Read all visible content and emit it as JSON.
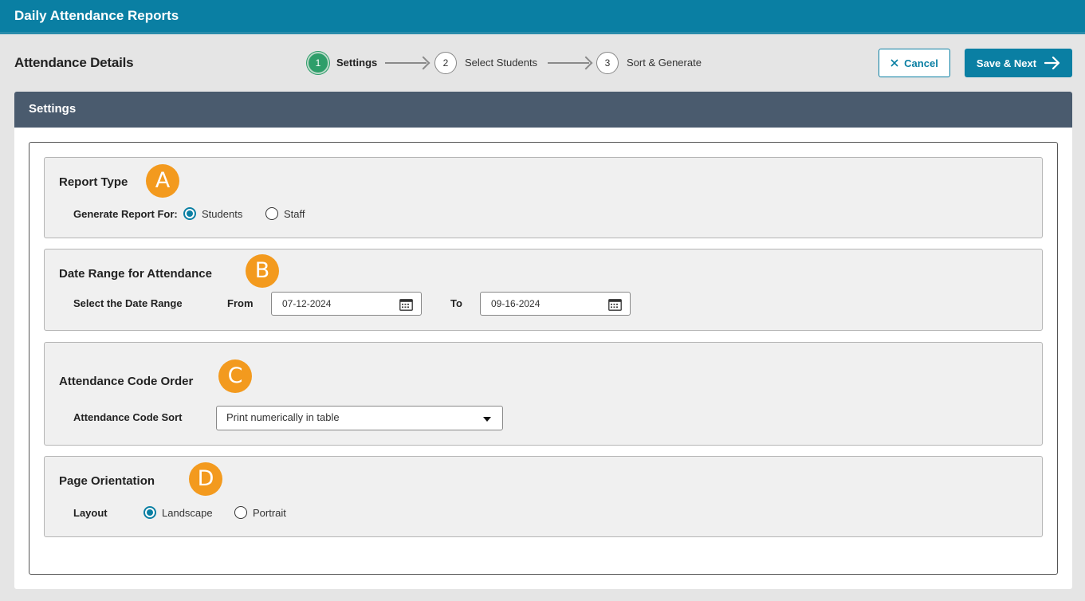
{
  "app": {
    "title": "Daily Attendance Reports"
  },
  "page": {
    "title": "Attendance Details"
  },
  "stepper": {
    "steps": [
      {
        "number": "1",
        "label": "Settings",
        "state": "active"
      },
      {
        "number": "2",
        "label": "Select Students",
        "state": "pending"
      },
      {
        "number": "3",
        "label": "Sort & Generate",
        "state": "pending"
      }
    ]
  },
  "actions": {
    "cancel_label": "Cancel",
    "cancel_icon": "close-icon",
    "save_label": "Save & Next",
    "save_icon": "arrow-right-icon"
  },
  "card": {
    "title": "Settings"
  },
  "sections": {
    "report_type": {
      "title": "Report Type",
      "badge": "A",
      "field_label": "Generate Report For:",
      "options": [
        {
          "label": "Students",
          "checked": true
        },
        {
          "label": "Staff",
          "checked": false
        }
      ]
    },
    "date_range": {
      "title": "Date Range for Attendance",
      "badge": "B",
      "field_label": "Select the Date Range",
      "from_label": "From",
      "from_value": "07-12-2024",
      "to_label": "To",
      "to_value": "09-16-2024"
    },
    "code_order": {
      "title": "Attendance Code Order",
      "badge": "C",
      "field_label": "Attendance Code Sort",
      "selected": "Print numerically in table"
    },
    "orientation": {
      "title": "Page Orientation",
      "badge": "D",
      "field_label": "Layout",
      "options": [
        {
          "label": "Landscape",
          "checked": true
        },
        {
          "label": "Portrait",
          "checked": false
        }
      ]
    }
  },
  "colors": {
    "brand": "#0a7fa3",
    "header_dark": "#4a5b6e",
    "badge": "#f39a1e",
    "step_active": "#2e9e6a"
  }
}
